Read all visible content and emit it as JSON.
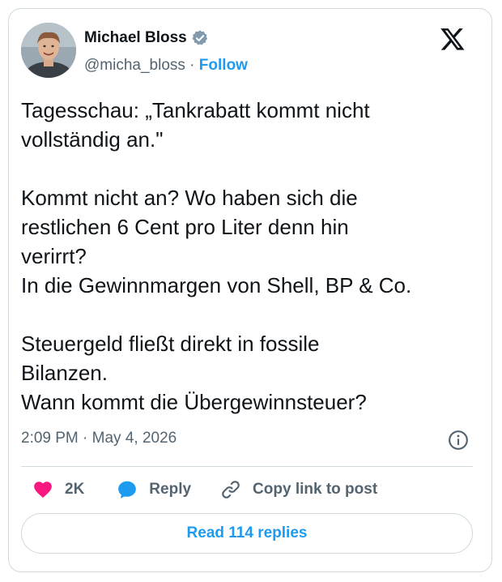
{
  "author": {
    "name": "Michael Bloss",
    "handle": "@micha_bloss",
    "separator": " · ",
    "follow_label": "Follow",
    "verified": true
  },
  "tweet": {
    "text": "Tagesschau: „Tankrabatt kommt nicht\nvollständig an.\"\n\nKommt nicht an? Wo haben sich die\nrestlichen 6 Cent pro Liter denn hin\nverirrt?\nIn die Gewinnmargen von Shell, BP & Co.\n\nSteuergeld fließt direkt in fossile\nBilanzen.\nWann kommt die Übergewinnsteuer?",
    "timestamp": "2:09 PM · May 4, 2026"
  },
  "actions": {
    "like_count": "2K",
    "reply_label": "Reply",
    "copy_link_label": "Copy link to post"
  },
  "read_replies_label": "Read 114 replies",
  "icons": [
    "verified-badge-icon",
    "x-logo-icon",
    "info-icon",
    "heart-icon",
    "reply-bubble-icon",
    "link-icon"
  ],
  "colors": {
    "accent": "#1d9bf0",
    "like": "#f91880",
    "text": "#0f1419",
    "muted": "#536471",
    "border": "#cfd9de"
  }
}
